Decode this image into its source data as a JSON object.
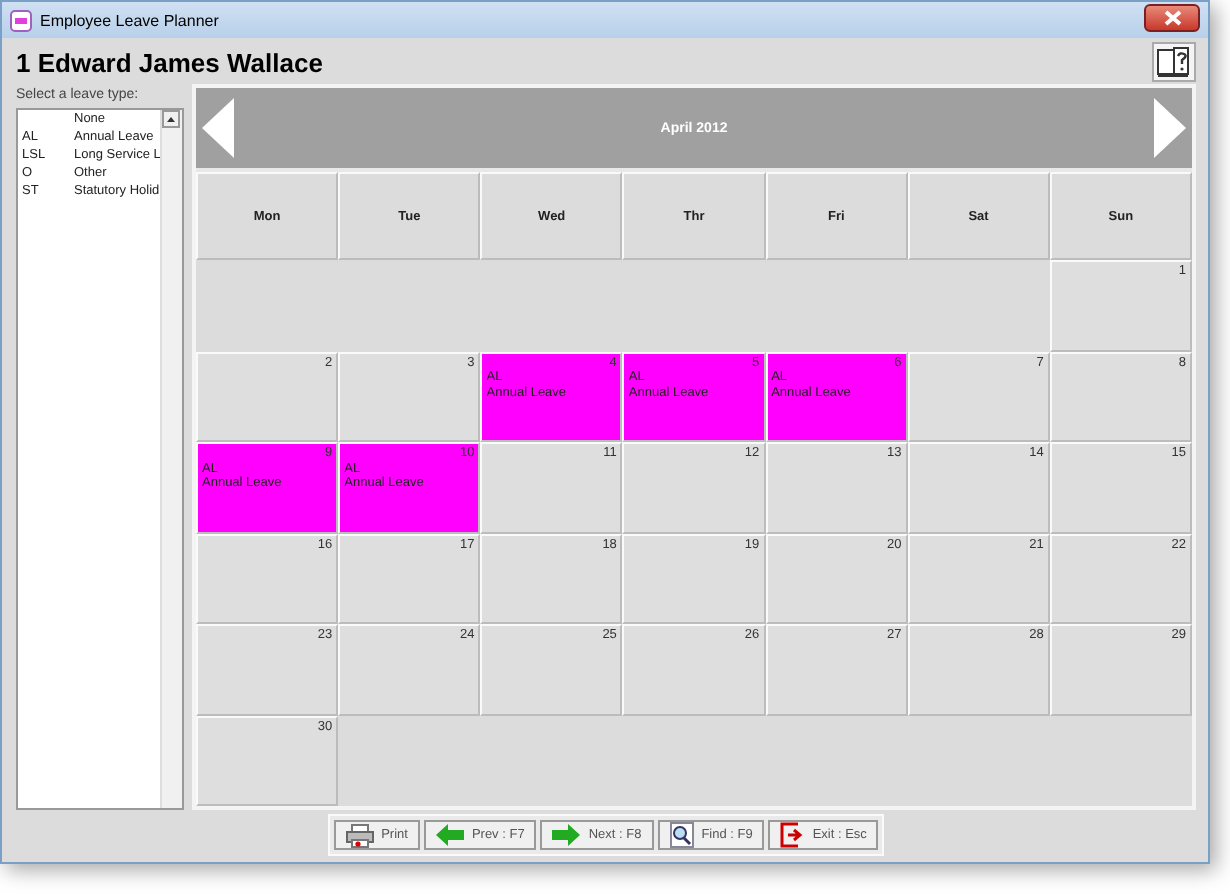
{
  "window": {
    "title": "Employee Leave Planner"
  },
  "employee": "1 Edward James Wallace",
  "leave_types": {
    "label": "Select a leave type:",
    "items": [
      {
        "name": "None"
      },
      {
        "code": "AL",
        "name": "Annual Leave"
      },
      {
        "code": "LSL",
        "name": "Long Service L"
      },
      {
        "code": "O",
        "name": "Other"
      },
      {
        "code": "ST",
        "name": "Statutory Holid"
      }
    ]
  },
  "calendar": {
    "month": "April 2012",
    "weekdays": [
      "Mon",
      "Tue",
      "Wed",
      "Thr",
      "Fri",
      "Sat",
      "Sun"
    ],
    "weeks": [
      {
        "kind": "trailing",
        "days": [
          {
            "day": "1"
          }
        ]
      },
      {
        "kind": "leading",
        "days": [
          {
            "day": "2"
          },
          {
            "day": "3"
          },
          {
            "day": "4",
            "leave": {
              "code": "AL",
              "name": "Annual Leave",
              "color": "#ff00ff"
            }
          },
          {
            "day": "5",
            "leave": {
              "code": "AL",
              "name": "Annual Leave",
              "color": "#ff00ff"
            }
          },
          {
            "day": "6",
            "leave": {
              "code": "AL",
              "name": "Annual Leave",
              "color": "#ff00ff"
            }
          },
          {
            "day": "7"
          },
          {
            "day": "8"
          }
        ]
      },
      {
        "kind": "leading",
        "days": [
          {
            "day": "9",
            "leave": {
              "code": "AL",
              "name": "Annual Leave",
              "color": "#ff00ff"
            }
          },
          {
            "day": "10",
            "leave": {
              "code": "AL",
              "name": "Annual Leave",
              "color": "#ff00ff"
            }
          },
          {
            "day": "11"
          },
          {
            "day": "12"
          },
          {
            "day": "13"
          },
          {
            "day": "14"
          },
          {
            "day": "15"
          }
        ]
      },
      {
        "kind": "leading",
        "days": [
          {
            "day": "16"
          },
          {
            "day": "17"
          },
          {
            "day": "18"
          },
          {
            "day": "19"
          },
          {
            "day": "20"
          },
          {
            "day": "21"
          },
          {
            "day": "22"
          }
        ]
      },
      {
        "kind": "leading",
        "days": [
          {
            "day": "23"
          },
          {
            "day": "24"
          },
          {
            "day": "25"
          },
          {
            "day": "26"
          },
          {
            "day": "27"
          },
          {
            "day": "28"
          },
          {
            "day": "29"
          }
        ]
      },
      {
        "kind": "leading",
        "days": [
          {
            "day": "30"
          }
        ]
      }
    ]
  },
  "buttons": [
    {
      "kind": "print",
      "label": "Print"
    },
    {
      "kind": "prev",
      "label": "Prev : F7"
    },
    {
      "kind": "next",
      "label": "Next : F8"
    },
    {
      "kind": "find",
      "label": "Find : F9"
    },
    {
      "kind": "exit",
      "label": "Exit : Esc"
    }
  ]
}
